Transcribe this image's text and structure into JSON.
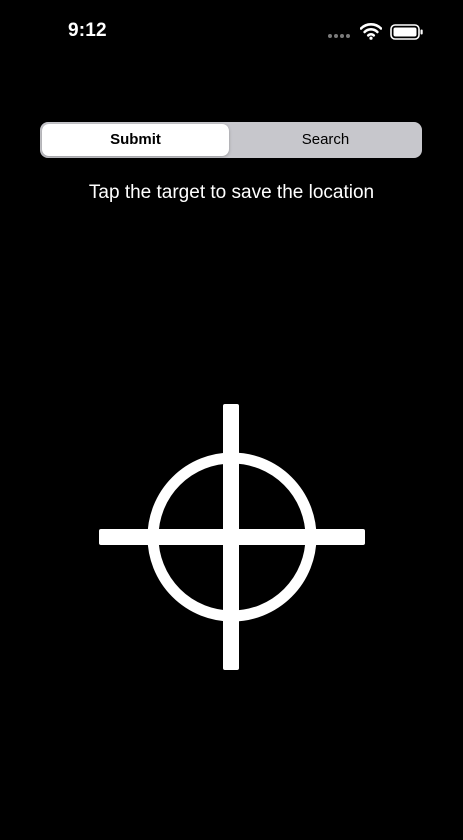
{
  "status_bar": {
    "time": "9:12",
    "icons": [
      "cellular-signal-icon",
      "wifi-icon",
      "battery-icon"
    ]
  },
  "segmented_control": {
    "segments": [
      {
        "label": "Submit",
        "selected": true
      },
      {
        "label": "Search",
        "selected": false
      }
    ]
  },
  "instruction_text": "Tap the target to save the location",
  "target": {
    "icon": "crosshair-target-icon"
  },
  "colors": {
    "background": "#000000",
    "foreground": "#ffffff",
    "segment_track": "#c7c7cc",
    "segment_selected": "#ffffff"
  }
}
